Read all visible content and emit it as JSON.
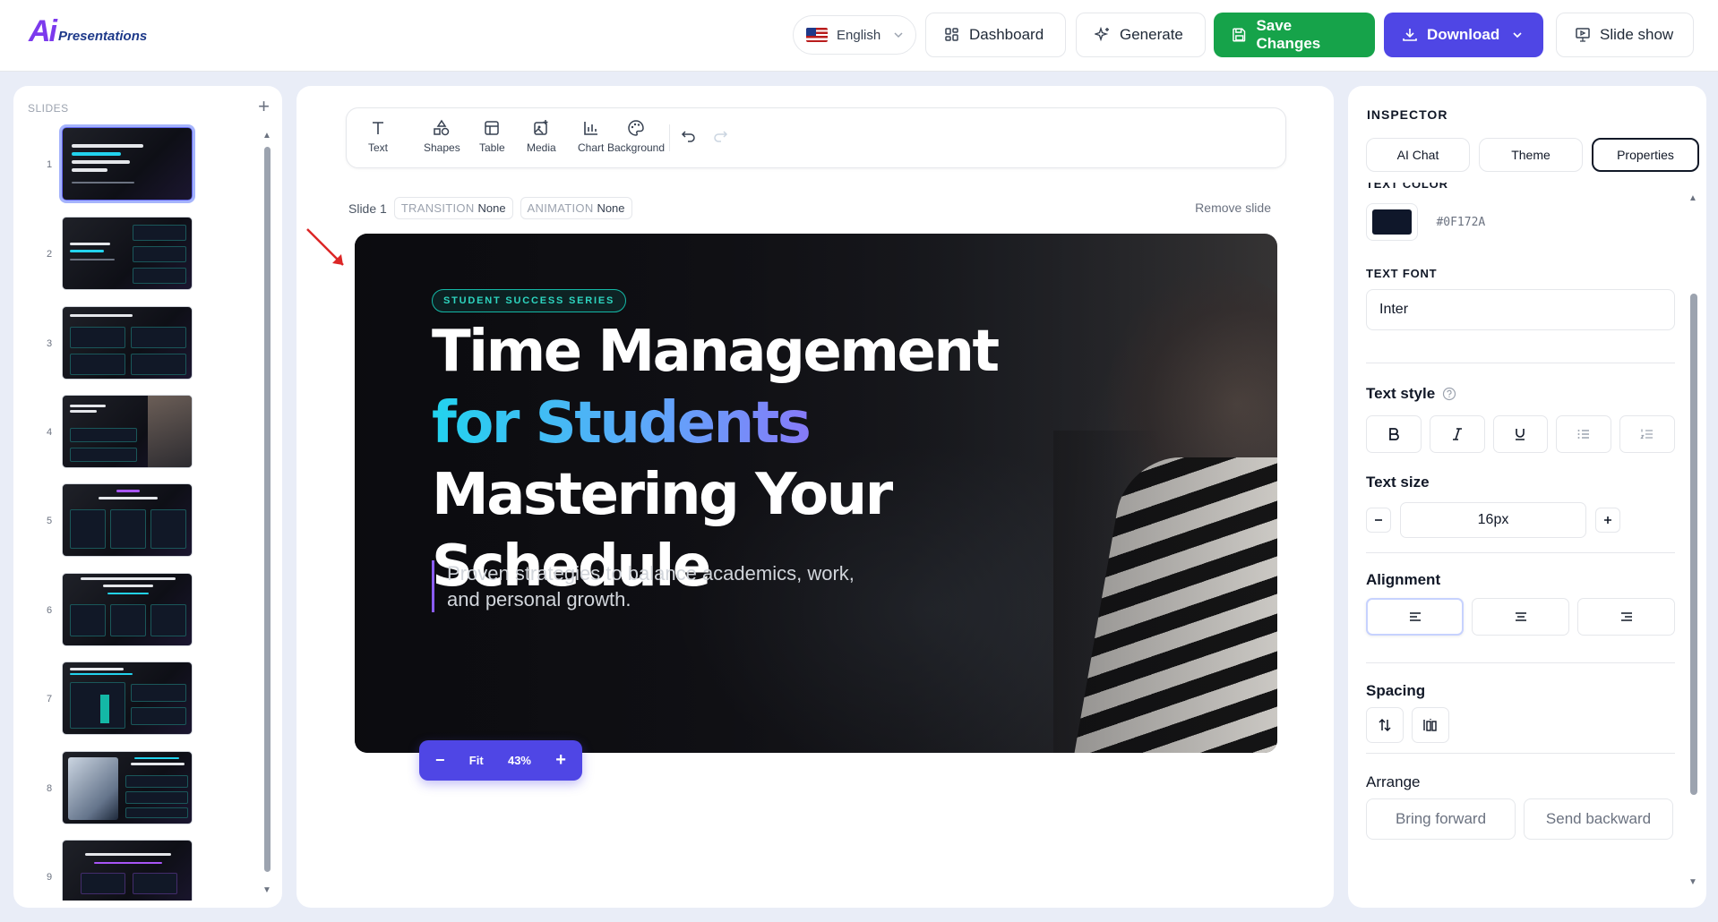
{
  "app": {
    "logo_mark": "Ai",
    "logo_text": "Presentations"
  },
  "topbar": {
    "language": "English",
    "dashboard": "Dashboard",
    "generate": "Generate",
    "save": "Save Changes",
    "download": "Download",
    "slideshow": "Slide show"
  },
  "slides_panel": {
    "title": "SLIDES",
    "add": "+",
    "numbers": [
      "1",
      "2",
      "3",
      "4",
      "5",
      "6",
      "7",
      "8",
      "9"
    ],
    "selected_index": 1
  },
  "toolbar": {
    "items": [
      "Text",
      "Shapes",
      "Table",
      "Media",
      "Chart",
      "Background"
    ]
  },
  "slide_meta": {
    "label": "Slide 1",
    "transition_label": "TRANSITION",
    "transition_value": "None",
    "animation_label": "ANIMATION",
    "animation_value": "None",
    "remove": "Remove slide"
  },
  "slide": {
    "badge": "STUDENT SUCCESS SERIES",
    "line1": "Time Management",
    "line2": "for Students",
    "line3": "Mastering Your",
    "line4": "Schedule",
    "subtitle": "Proven strategies to balance academics, work, and personal growth."
  },
  "zoom": {
    "fit": "Fit",
    "level": "43%",
    "minus": "−",
    "plus": "+"
  },
  "inspector": {
    "title": "INSPECTOR",
    "tabs": [
      "AI Chat",
      "Theme",
      "Properties"
    ],
    "active_tab": "Properties",
    "text_color_label": "TEXT COLOR",
    "text_color_hex": "#0F172A",
    "text_font_label": "TEXT FONT",
    "text_font_value": "Inter",
    "text_style_label": "Text style",
    "text_size_label": "Text size",
    "text_size_value": "16px",
    "alignment_label": "Alignment",
    "spacing_label": "Spacing",
    "arrange_label": "Arrange",
    "bring_forward": "Bring forward",
    "send_backward": "Send backward"
  },
  "colors": {
    "accent": "#4f46e5",
    "save_green": "#16a34a",
    "text_color": "#0F172A"
  }
}
